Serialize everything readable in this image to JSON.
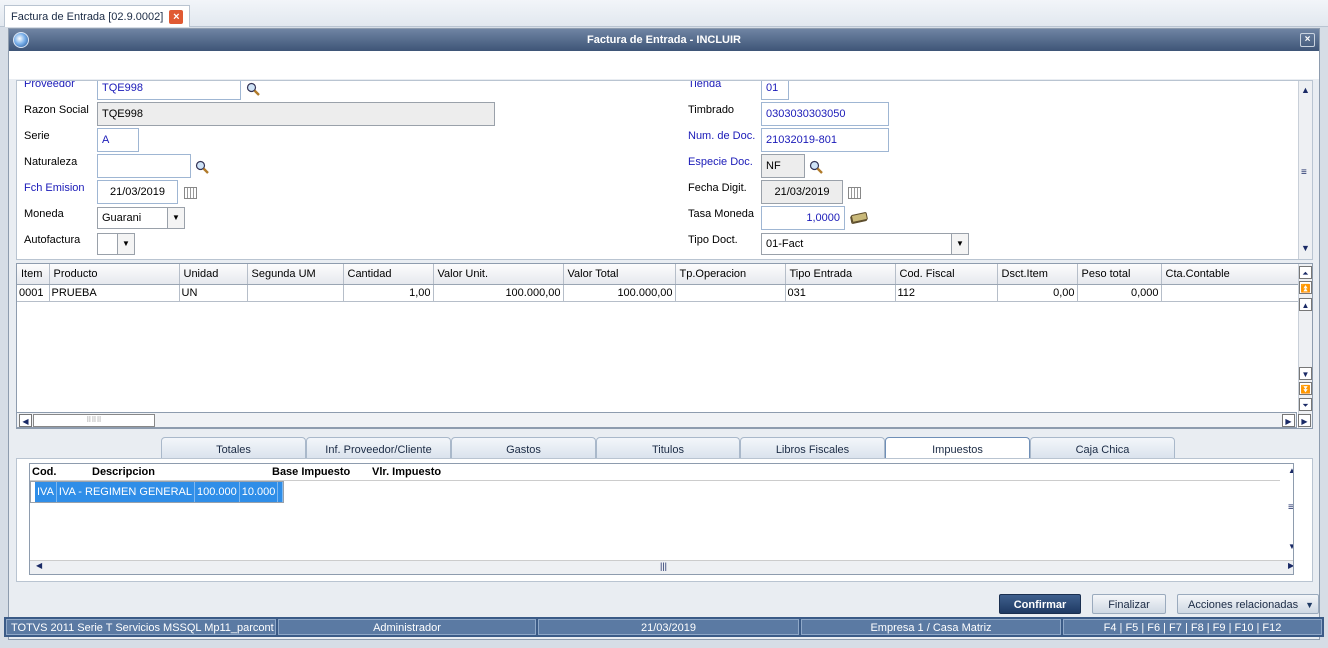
{
  "tab": {
    "title": "Factura de Entrada [02.9.0002]"
  },
  "window": {
    "title": "Factura de Entrada - INCLUIR"
  },
  "form": {
    "proveedor_label": "Proveedor",
    "proveedor": "TQE998",
    "razon_label": "Razon Social",
    "razon": "TQE998",
    "serie_label": "Serie",
    "serie": "A",
    "naturaleza_label": "Naturaleza",
    "naturaleza": "",
    "fch_label": "Fch Emision",
    "fch": "21/03/2019",
    "moneda_label": "Moneda",
    "moneda": "Guarani",
    "autofactura_label": "Autofactura",
    "autofactura": "",
    "tienda_label": "Tienda",
    "tienda": "01",
    "timbrado_label": "Timbrado",
    "timbrado": "0303030303050",
    "numdoc_label": "Num. de Doc.",
    "numdoc": "21032019-801",
    "especie_label": "Especie Doc.",
    "especie": "NF",
    "fechadigit_label": "Fecha Digit.",
    "fechadigit": "21/03/2019",
    "tasa_label": "Tasa Moneda",
    "tasa": "1,0000",
    "tipodoc_label": "Tipo Doct.",
    "tipodoc": "01-Fact"
  },
  "grid": {
    "columns": [
      "Item",
      "Producto",
      "Unidad",
      "Segunda UM",
      "Cantidad",
      "Valor Unit.",
      "Valor Total",
      "Tp.Operacion",
      "Tipo Entrada",
      "Cod. Fiscal",
      "Dsct.Item",
      "Peso total",
      "Cta.Contable"
    ],
    "rows": [
      [
        "0001",
        "PRUEBA",
        "UN",
        "",
        "1,00",
        "100.000,00",
        "100.000,00",
        "",
        "031",
        "112",
        "0,00",
        "0,000",
        ""
      ]
    ]
  },
  "tabs": [
    "Totales",
    "Inf. Proveedor/Cliente",
    "Gastos",
    "Titulos",
    "Libros Fiscales",
    "Impuestos",
    "Caja Chica"
  ],
  "active_tab": "Impuestos",
  "tax": {
    "columns": [
      "Cod.",
      "Descripcion",
      "Base Impuesto",
      "Vlr. Impuesto"
    ],
    "rows": [
      [
        "IVA",
        "IVA - REGIMEN GENERAL",
        "100.000",
        "10.000"
      ]
    ]
  },
  "buttons": {
    "confirm": "Confirmar",
    "finish": "Finalizar",
    "related": "Acciones relacionadas"
  },
  "status": {
    "system": "TOTVS 2011 Serie T Servicios MSSQL Mp11_parcont",
    "user": "Administrador",
    "date": "21/03/2019",
    "company": "Empresa 1 / Casa Matriz",
    "keys": "F4 | F5 | F6 | F7 | F8 | F9 | F10 | F12"
  },
  "colors": {
    "accent": "#3e5577",
    "selection": "#2f8ee8",
    "label_blue": "#1a1ab8"
  }
}
